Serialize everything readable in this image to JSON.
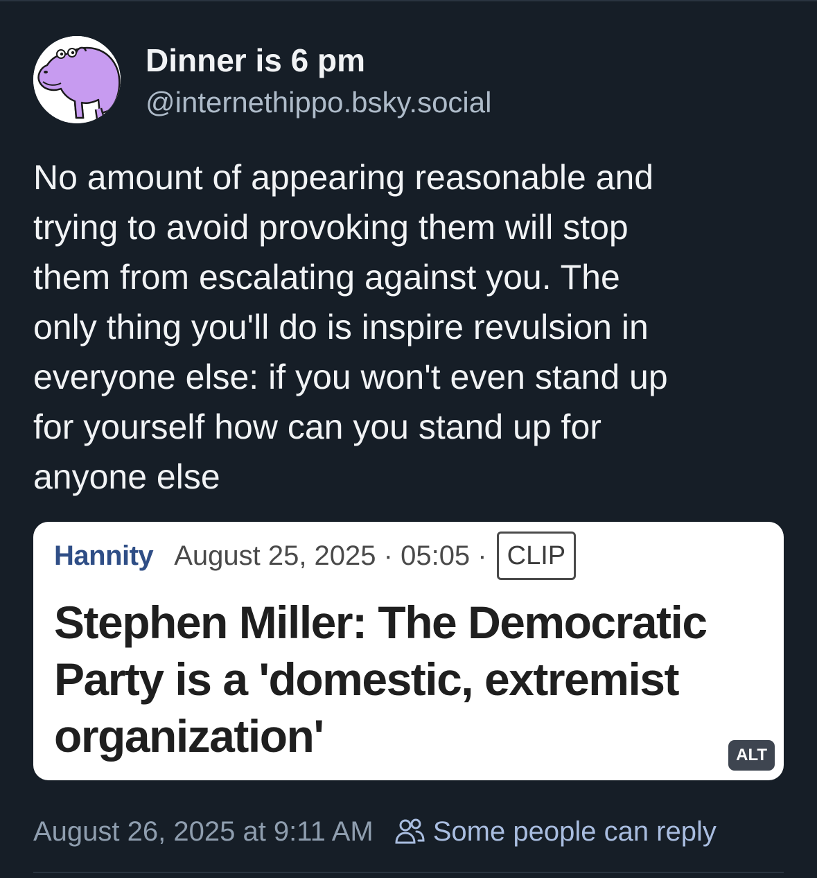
{
  "author": {
    "display_name": "Dinner is 6 pm",
    "handle": "@internethippo.bsky.social",
    "avatar_icon": "hippo-avatar-icon"
  },
  "post": {
    "text": "No amount of appearing reasonable and\ntrying to avoid provoking them will stop\nthem from escalating against you. The\nonly thing you'll do is inspire revulsion in\neveryone else: if you won't even stand up\nfor yourself how can you stand up for\nanyone else",
    "timestamp": "August 26, 2025 at 9:11 AM",
    "reply_setting": "Some people can reply",
    "reply_icon": "people-icon"
  },
  "embed": {
    "source": "Hannity",
    "date_line": "August 25, 2025 · 05:05 ·",
    "clip_label": "CLIP",
    "headline": "Stephen Miller: The Democratic\nParty is a 'domestic, extremist\norganization'",
    "alt_label": "ALT"
  },
  "colors": {
    "background": "#161e27",
    "name_text": "#f1f3f5",
    "handle_text": "#aebbc9",
    "timestamp_text": "#8f9eaf",
    "reply_setting_text": "#a9bde0",
    "source_brand": "#2f4e86",
    "avatar_hippo": "#c79bf0"
  }
}
